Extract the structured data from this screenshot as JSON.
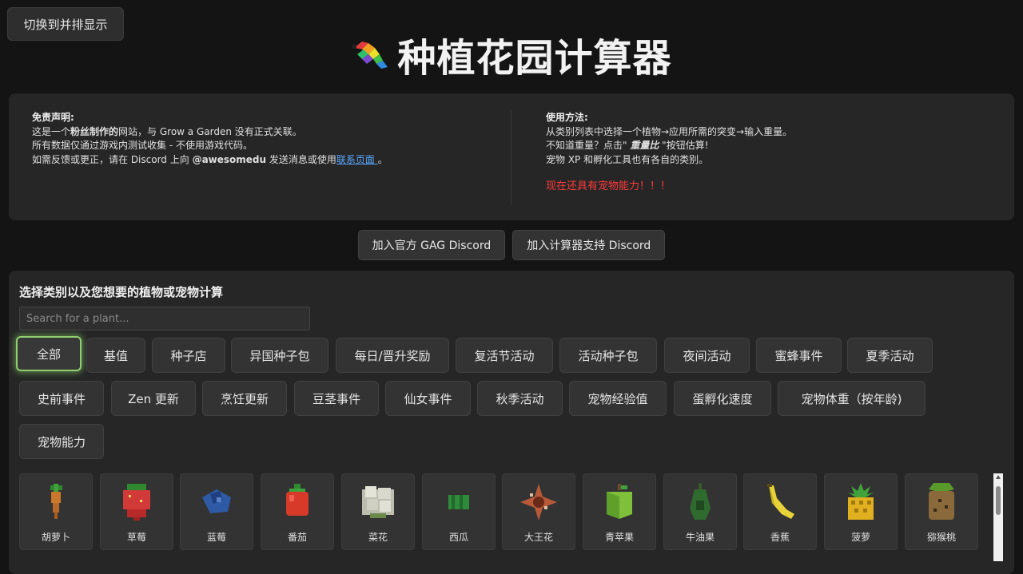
{
  "toggle_label": "切换到并排显示",
  "title": "种植花园计算器",
  "disclaimer": {
    "heading": "免责声明:",
    "line1_pre": "这是一个",
    "line1_bold": "粉丝制作的",
    "line1_post": "网站，与 Grow a Garden 没有正式关联。",
    "line2": "所有数据仅通过游戏内测试收集 - 不使用游戏代码。",
    "line3_pre": "如需反馈或更正，请在 Discord 上向 ",
    "line3_handle": "@awesomedu",
    "line3_mid": " 发送消息或使用",
    "line3_link": "联系页面 ",
    "line3_end": "。"
  },
  "usage": {
    "heading": "使用方法:",
    "line1": "从类别列表中选择一个植物→应用所需的突变→输入重量。",
    "line2_pre": "不知道重量？点击\" ",
    "line2_em": "重量比",
    "line2_post": " \"按钮估算!",
    "line3": "宠物 XP 和孵化工具也有各自的类别。",
    "red_note": "现在还具有宠物能力！！！"
  },
  "discord_buttons": [
    "加入官方 GAG Discord",
    "加入计算器支持 Discord"
  ],
  "select_heading": "选择类别以及您想要的植物或宠物计算",
  "search_placeholder": "Search for a plant...",
  "categories": [
    "全部",
    "基值",
    "种子店",
    "异国种子包",
    "每日/晋升奖励",
    "复活节活动",
    "活动种子包",
    "夜间活动",
    "蜜蜂事件",
    "夏季活动",
    "史前事件",
    "Zen 更新",
    "烹饪更新",
    "豆茎事件",
    "仙女事件",
    "秋季活动",
    "宠物经验值",
    "蛋孵化速度",
    "宠物体重（按年龄)",
    "宠物能力"
  ],
  "active_category": "全部",
  "plants": [
    {
      "name": "胡萝卜",
      "icon": "carrot-icon",
      "color": "#c9772a"
    },
    {
      "name": "草莓",
      "icon": "strawberry-icon",
      "color": "#d23a3a"
    },
    {
      "name": "蓝莓",
      "icon": "blueberry-icon",
      "color": "#2e5aa6"
    },
    {
      "name": "番茄",
      "icon": "tomato-icon",
      "color": "#d83a2a"
    },
    {
      "name": "菜花",
      "icon": "cauliflower-icon",
      "color": "#d8d8c8"
    },
    {
      "name": "西瓜",
      "icon": "watermelon-icon",
      "color": "#2f8a3a"
    },
    {
      "name": "大王花",
      "icon": "rafflesia-icon",
      "color": "#b85a3a"
    },
    {
      "name": "青苹果",
      "icon": "green-apple-icon",
      "color": "#7fbf3a"
    },
    {
      "name": "牛油果",
      "icon": "avocado-icon",
      "color": "#2f6a2f"
    },
    {
      "name": "香蕉",
      "icon": "banana-icon",
      "color": "#e8d23a"
    },
    {
      "name": "菠萝",
      "icon": "pineapple-icon",
      "color": "#e0b020"
    },
    {
      "name": "猕猴桃",
      "icon": "kiwi-icon",
      "color": "#8a6a3a"
    }
  ]
}
